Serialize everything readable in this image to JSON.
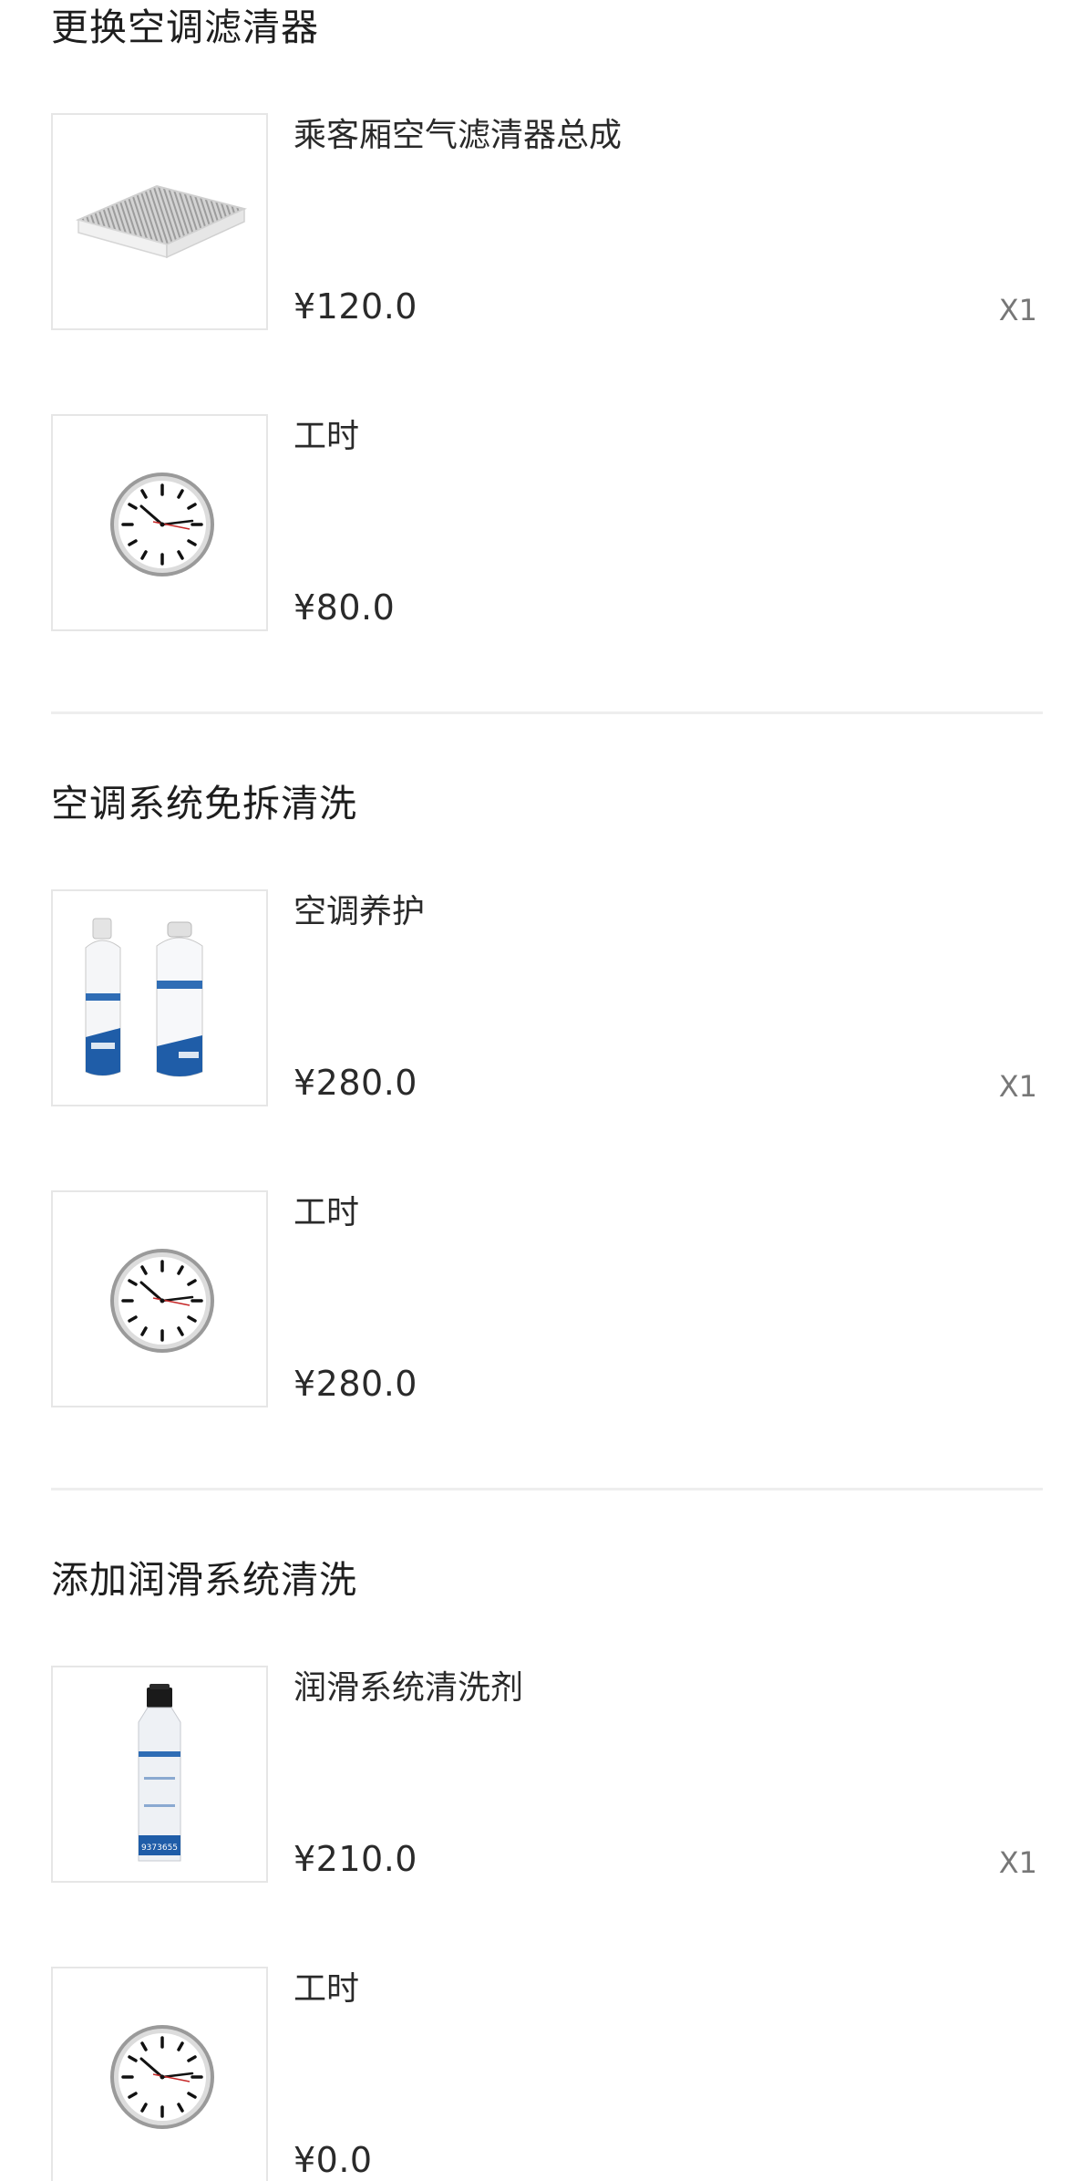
{
  "sections": [
    {
      "title": "更换空调滤清器",
      "items": [
        {
          "name": "乘客厢空气滤清器总成",
          "price": "¥120.0",
          "qty": "X1",
          "image": "cabin-air-filter-image"
        },
        {
          "name": "工时",
          "price": "¥80.0",
          "qty": "",
          "image": "clock-icon"
        }
      ]
    },
    {
      "title": "空调系统免拆清洗",
      "items": [
        {
          "name": "空调养护",
          "price": "¥280.0",
          "qty": "X1",
          "image": "ac-cleaner-cans-image"
        },
        {
          "name": "工时",
          "price": "¥280.0",
          "qty": "",
          "image": "clock-icon"
        }
      ]
    },
    {
      "title": "添加润滑系统清洗",
      "items": [
        {
          "name": "润滑系统清洗剂",
          "price": "¥210.0",
          "qty": "X1",
          "image": "lubrication-cleaner-bottle-image"
        },
        {
          "name": "工时",
          "price": "¥0.0",
          "qty": "",
          "image": "clock-icon"
        }
      ]
    }
  ],
  "product_label": {
    "bottle_code": "9373655"
  }
}
